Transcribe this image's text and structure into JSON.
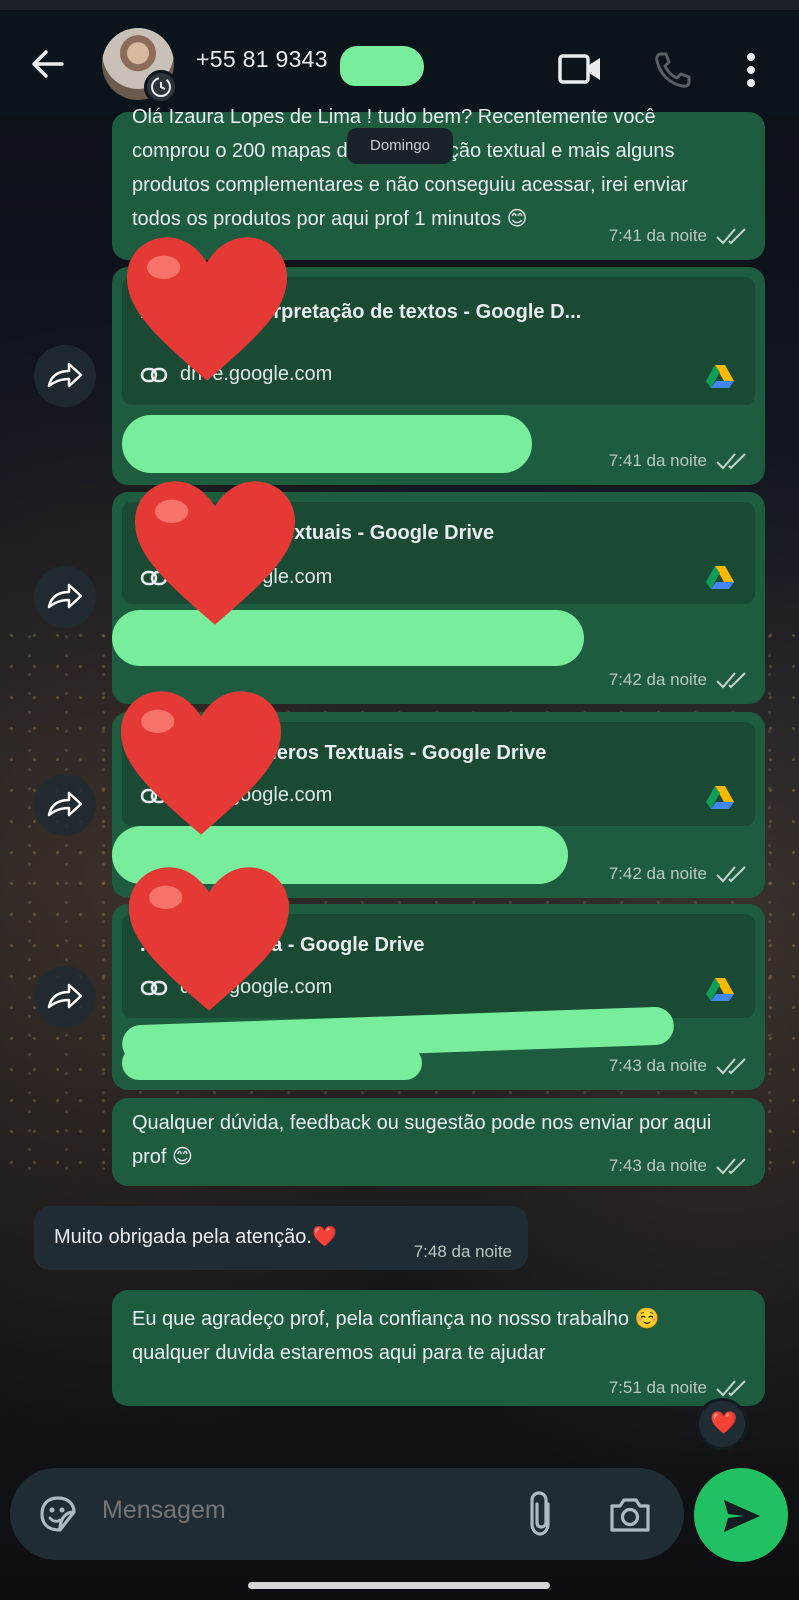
{
  "header": {
    "contact_name": "+55 81 9343",
    "colors": {
      "bar": "#0b141a",
      "accent": "#21c063"
    }
  },
  "date_chip": "Domingo",
  "messages": [
    {
      "text": "Olá Izaura Lopes de Lima ! tudo bem? Recentemente você comprou o 200 mapas de interpretação textual  e mais alguns produtos complementares e não conseguiu acessar, irei enviar todos os produtos por aqui prof 1 minutos 😊",
      "time": "7:41 da noite"
    },
    {
      "link_title": "...ntais de interpretação de textos - Google D...",
      "link_domain": "drive.google.com",
      "time": "7:41 da noite"
    },
    {
      "link_title": "...de Gêneros Textuais - Google Drive",
      "link_domain": "drive.google.com",
      "time": "7:42 da noite"
    },
    {
      "link_title": "...ntais de Gêneros Textuais - Google Drive",
      "link_domain": "drive.google.com",
      "time": "7:42 da noite"
    },
    {
      "link_title": "...de Ortografia - Google Drive",
      "link_domain": "drive.google.com",
      "time": "7:43 da noite"
    },
    {
      "text": "Qualquer dúvida, feedback ou sugestão pode nos enviar por aqui prof 😊",
      "time": "7:43 da noite"
    },
    {
      "text": "Muito obrigada pela atenção.❤️",
      "time": "7:48 da noite"
    },
    {
      "text": "Eu que agradeço prof, pela confiança no nosso trabalho ☺️ qualquer duvida estaremos aqui para te ajudar",
      "time": "7:51 da noite"
    }
  ],
  "reaction": "❤️",
  "composer": {
    "placeholder": "Mensagem"
  }
}
